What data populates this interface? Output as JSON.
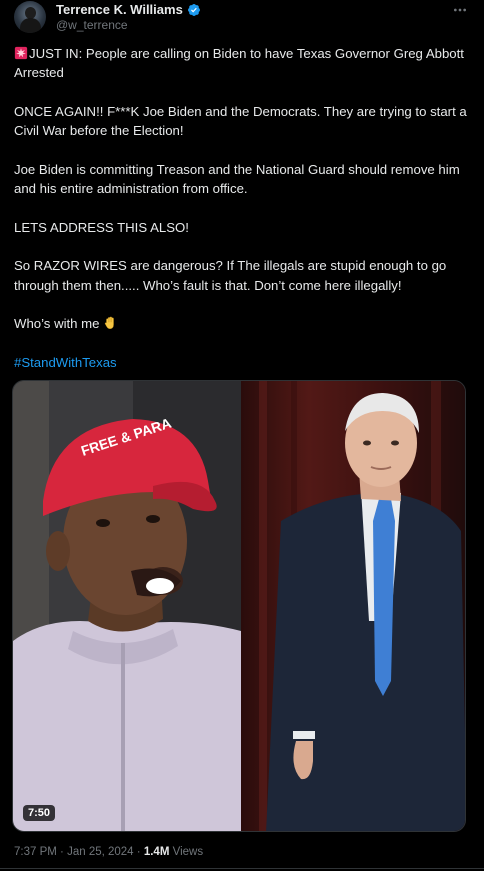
{
  "author": {
    "name": "Terrence K. Williams",
    "handle": "@w_terrence",
    "verified_color": "#1d9bf0"
  },
  "post": {
    "paragraphs": [
      "JUST IN: People are calling on Biden to have Texas Governor Greg Abbott Arrested",
      "ONCE AGAIN!!  F***K  Joe Biden and the Democrats. They are trying to start a Civil War before the Election!",
      "Joe Biden is committing Treason and the National Guard should remove him and his entire administration from office.",
      "LETS ADDRESS THIS ALSO!",
      "So RAZOR WIRES are dangerous? If The illegals are stupid enough to go through them then..... Who’s fault is that. Don’t come here illegally!",
      "Who’s with me"
    ],
    "hashtag": "#StandWithTexas",
    "hashtag_color": "#1d9bf0"
  },
  "media": {
    "duration": "7:50",
    "hat_text": "FREE & PARA"
  },
  "meta": {
    "time": "7:37 PM",
    "separator": "·",
    "date": "Jan 25, 2024",
    "views_count": "1.4M",
    "views_label": "Views"
  },
  "icons": {
    "siren": "siren-emoji-icon",
    "hand": "raised-hand-emoji-icon",
    "verified": "verified-badge-icon",
    "more": "more-options-icon"
  }
}
